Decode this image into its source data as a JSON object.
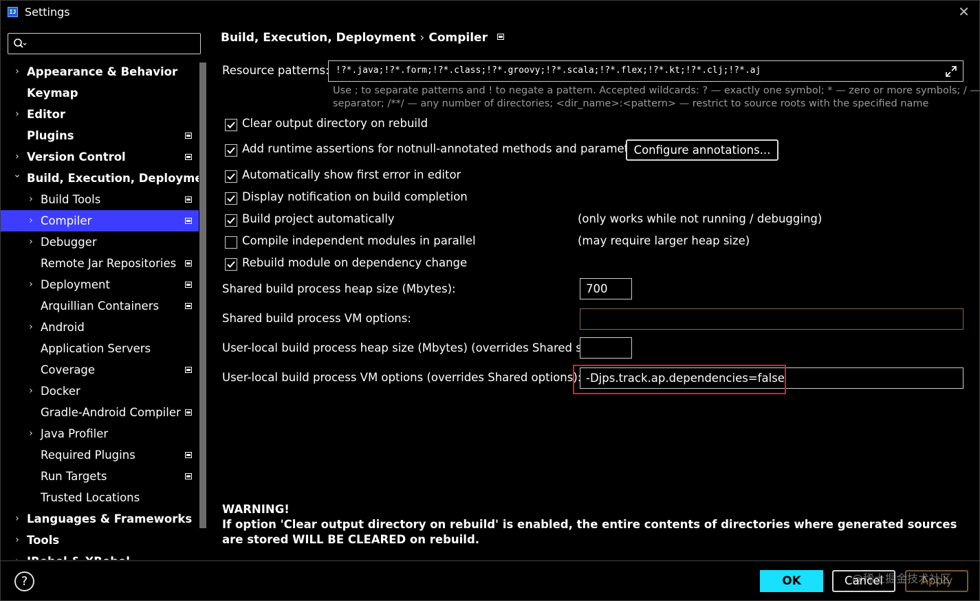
{
  "window": {
    "title": "Settings",
    "app_icon_text": "IJ"
  },
  "search": {
    "value": "",
    "placeholder": ""
  },
  "sidebar": {
    "items": [
      {
        "label": "Appearance & Behavior",
        "level": 0,
        "expandable": true,
        "project": false
      },
      {
        "label": "Keymap",
        "level": 0,
        "expandable": false,
        "project": false
      },
      {
        "label": "Editor",
        "level": 0,
        "expandable": true,
        "project": false
      },
      {
        "label": "Plugins",
        "level": 0,
        "expandable": false,
        "project": true
      },
      {
        "label": "Version Control",
        "level": 0,
        "expandable": true,
        "project": true
      },
      {
        "label": "Build, Execution, Deployment",
        "level": 0,
        "expandable": true,
        "expanded": true,
        "project": false
      },
      {
        "label": "Build Tools",
        "level": 1,
        "expandable": true,
        "project": true
      },
      {
        "label": "Compiler",
        "level": 1,
        "expandable": true,
        "project": true,
        "selected": true
      },
      {
        "label": "Debugger",
        "level": 1,
        "expandable": true,
        "project": false
      },
      {
        "label": "Remote Jar Repositories",
        "level": 1,
        "expandable": false,
        "project": true
      },
      {
        "label": "Deployment",
        "level": 1,
        "expandable": true,
        "project": true
      },
      {
        "label": "Arquillian Containers",
        "level": 1,
        "expandable": false,
        "project": true
      },
      {
        "label": "Android",
        "level": 1,
        "expandable": true,
        "project": false
      },
      {
        "label": "Application Servers",
        "level": 1,
        "expandable": false,
        "project": false
      },
      {
        "label": "Coverage",
        "level": 1,
        "expandable": false,
        "project": true
      },
      {
        "label": "Docker",
        "level": 1,
        "expandable": true,
        "project": false
      },
      {
        "label": "Gradle-Android Compiler",
        "level": 1,
        "expandable": false,
        "project": true
      },
      {
        "label": "Java Profiler",
        "level": 1,
        "expandable": true,
        "project": false
      },
      {
        "label": "Required Plugins",
        "level": 1,
        "expandable": false,
        "project": true
      },
      {
        "label": "Run Targets",
        "level": 1,
        "expandable": false,
        "project": true
      },
      {
        "label": "Trusted Locations",
        "level": 1,
        "expandable": false,
        "project": false
      },
      {
        "label": "Languages & Frameworks",
        "level": 0,
        "expandable": true,
        "project": false
      },
      {
        "label": "Tools",
        "level": 0,
        "expandable": true,
        "project": false
      },
      {
        "label": "JRebel & XRebel",
        "level": 0,
        "expandable": true,
        "project": false
      }
    ]
  },
  "breadcrumb": {
    "parent": "Build, Execution, Deployment",
    "separator": "›",
    "current": "Compiler"
  },
  "resource_patterns": {
    "label": "Resource patterns:",
    "value": "!?*.java;!?*.form;!?*.class;!?*.groovy;!?*.scala;!?*.flex;!?*.kt;!?*.clj;!?*.aj",
    "hint_line1": "Use ; to separate patterns and ! to negate a pattern. Accepted wildcards: ? — exactly one symbol; * — zero or more symbols; / — path",
    "hint_line2": "separator; /**/ — any number of directories; <dir_name>:<pattern> — restrict to source roots with the specified name"
  },
  "checkboxes": [
    {
      "label": "Clear output directory on rebuild",
      "checked": true,
      "note": ""
    },
    {
      "label": "Add runtime assertions for notnull-annotated methods and parameters",
      "checked": true,
      "note": ""
    },
    {
      "label": "Automatically show first error in editor",
      "checked": true,
      "note": ""
    },
    {
      "label": "Display notification on build completion",
      "checked": true,
      "note": ""
    },
    {
      "label": "Build project automatically",
      "checked": true,
      "note": "(only works while not running / debugging)"
    },
    {
      "label": "Compile independent modules in parallel",
      "checked": false,
      "note": "(may require larger heap size)"
    },
    {
      "label": "Rebuild module on dependency change",
      "checked": true,
      "note": ""
    }
  ],
  "configure_button": "Configure annotations...",
  "fields": {
    "shared_heap": {
      "label": "Shared build process heap size (Mbytes):",
      "value": "700"
    },
    "shared_vm": {
      "label": "Shared build process VM options:",
      "value": ""
    },
    "user_heap": {
      "label": "User-local build process heap size (Mbytes) (overrides Shared size):",
      "value": ""
    },
    "user_vm": {
      "label": "User-local build process VM options (overrides Shared options):",
      "value": "-Djps.track.ap.dependencies=false"
    }
  },
  "warning": {
    "title": "WARNING!",
    "text": "If option 'Clear output directory on rebuild' is enabled, the entire contents of directories where generated sources are stored WILL BE CLEARED on rebuild."
  },
  "footer": {
    "help": "?",
    "ok": "OK",
    "cancel": "Cancel",
    "apply": "Apply"
  },
  "watermark": "@稀土掘金技术社区",
  "colors": {
    "selection": "#3d3dff",
    "ok_button": "#17e1ff",
    "highlight_box": "#e0202a"
  }
}
